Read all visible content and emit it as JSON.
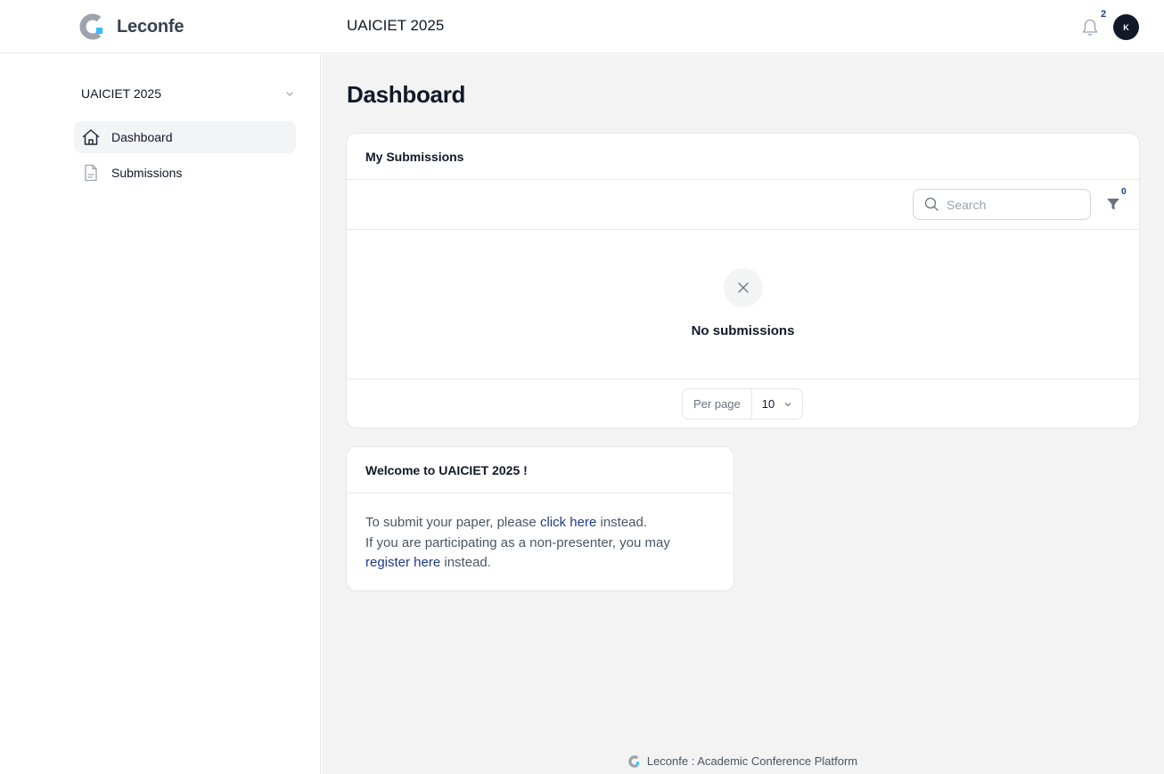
{
  "header": {
    "brand_name": "Leconfe",
    "conference_title": "UAICIET 2025",
    "notification_count": "2",
    "avatar_initial": "K"
  },
  "sidebar": {
    "conference_switcher": "UAICIET 2025",
    "items": [
      {
        "label": "Dashboard",
        "icon": "home-icon",
        "active": true
      },
      {
        "label": "Submissions",
        "icon": "document-icon",
        "active": false
      }
    ]
  },
  "main": {
    "page_title": "Dashboard",
    "submissions_card": {
      "title": "My Submissions",
      "search_placeholder": "Search",
      "filter_count": "0",
      "empty_text": "No submissions",
      "per_page_label": "Per page",
      "per_page_value": "10"
    },
    "welcome_card": {
      "title": "Welcome to UAICIET 2025 !",
      "line1_before": "To submit your paper, please ",
      "line1_link": "click here",
      "line1_after": " instead.",
      "line2": "If you are participating as a non-presenter, you may",
      "line3_link": "register here",
      "line3_after": " instead."
    }
  },
  "footer": {
    "text": "Leconfe : Academic Conference Platform"
  },
  "colors": {
    "accent": "#1e3a8a",
    "logo_blue": "#38bdf8",
    "logo_gray": "#9ca3af",
    "main_bg": "#f3f3f3"
  }
}
